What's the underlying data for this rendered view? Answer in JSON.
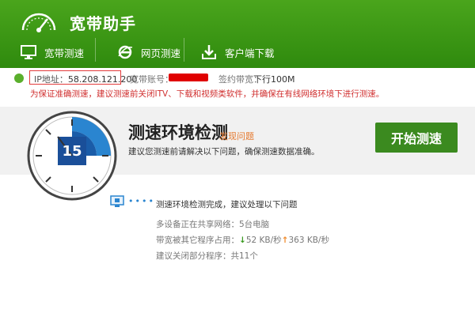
{
  "app": {
    "title": "宽带助手"
  },
  "tabs": [
    {
      "label": "宽带测速",
      "icon": "monitor-icon"
    },
    {
      "label": "网页测速",
      "icon": "ie-browser-icon"
    },
    {
      "label": "客户端下载",
      "icon": "download-icon"
    }
  ],
  "info": {
    "ip_label": "IP地址：",
    "ip_value": "58.208.121.200",
    "account_label": "宽带账号：",
    "plan_label": "签约带宽：",
    "plan_value": "下行100M",
    "warning": "为保证准确测速，建议测速前关闭ITV、下载和视频类软件，并确保在有线网络环境下进行测速。"
  },
  "gauge": {
    "value": "15"
  },
  "status": {
    "title": "测速环境检测",
    "badge": "发现问题",
    "description": "建议您测速前请解决以下问题，确保测速数据准确。",
    "start_button": "开始测速"
  },
  "details": {
    "dots": "••••",
    "head": "测速环境检测完成，建议处理以下问题",
    "line1": "多设备正在共享网络：5台电脑",
    "line2_prefix": "带宽被其它程序占用：",
    "down_speed": "52 KB/秒",
    "up_speed": "363 KB/秒",
    "line3": "建议关闭部分程序：共11个"
  },
  "colors": {
    "brand_green": "#3b8a1f",
    "warning_red": "#d03030",
    "accent_blue": "#2a85d0"
  }
}
